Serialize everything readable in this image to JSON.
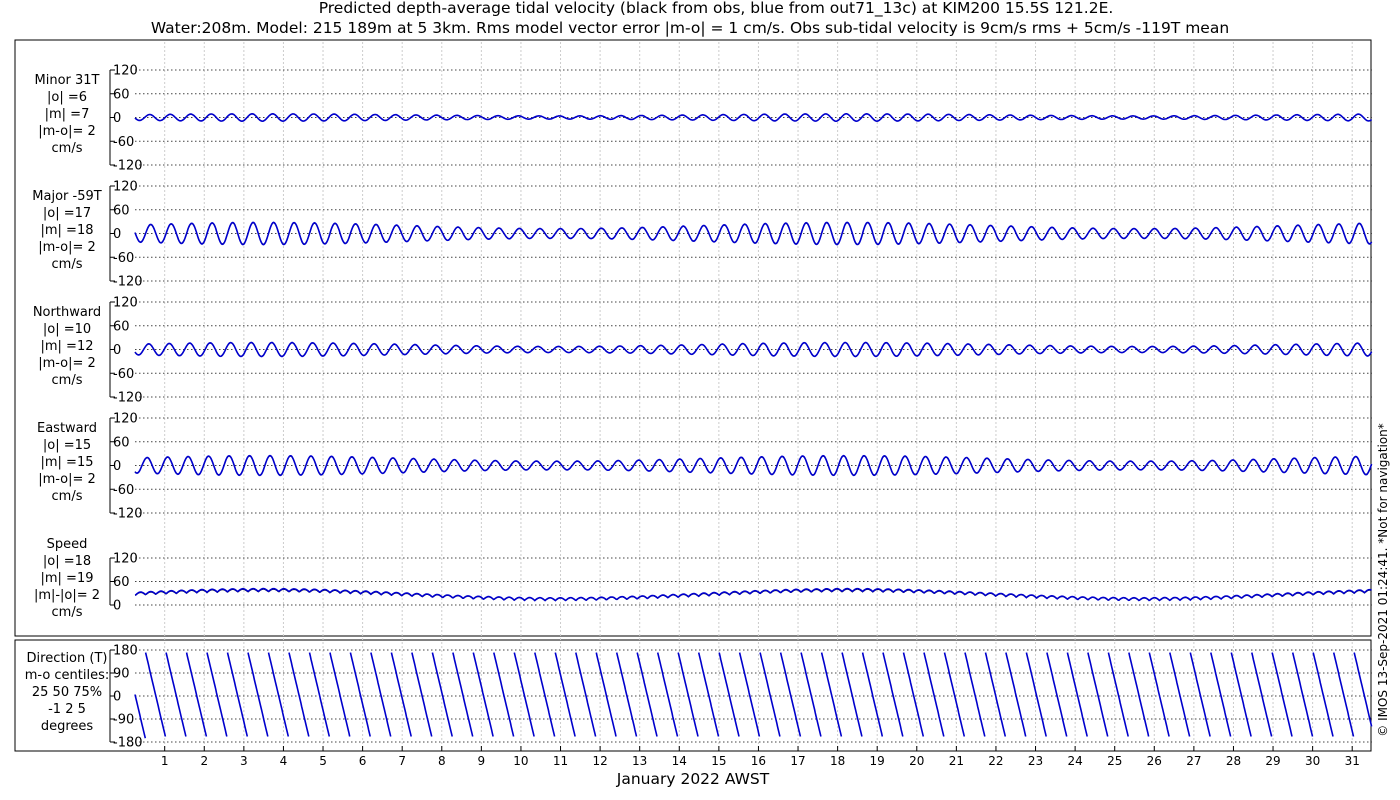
{
  "title_line1": "Predicted depth-average tidal velocity (black from obs, blue from out71_13c) at KIM200 15.5S 121.2E.",
  "title_line2": "Water:208m. Model: 215 189m at 5 3km. Rms model vector error |m-o| = 1 cm/s. Obs sub-tidal velocity is 9cm/s rms + 5cm/s -119T mean",
  "xlabel": "January 2022 AWST",
  "copyright": "© IMOS 13-Sep-2021 01:24:41. *Not for navigation*",
  "colors": {
    "obs": "#000000",
    "model": "#0000cc"
  },
  "chart_data": {
    "type": "line",
    "x_day_range": [
      0.25,
      31.5
    ],
    "x_ticks": [
      "1",
      "2",
      "3",
      "4",
      "5",
      "6",
      "7",
      "8",
      "9",
      "10",
      "11",
      "12",
      "13",
      "14",
      "15",
      "16",
      "17",
      "18",
      "19",
      "20",
      "21",
      "22",
      "23",
      "24",
      "25",
      "26",
      "27",
      "28",
      "29",
      "30",
      "31"
    ],
    "panels": [
      {
        "key": "minor",
        "labels": [
          "Minor 31T",
          "|o| =6",
          "|m| =7",
          "|m-o|= 2",
          "cm/s"
        ],
        "ylim": [
          -120,
          120
        ],
        "yticks": [
          "120",
          "60",
          "0",
          "-60",
          "-120"
        ],
        "amplitude": 9,
        "mean": 0
      },
      {
        "key": "major",
        "labels": [
          "Major -59T",
          "|o| =17",
          "|m| =18",
          "|m-o|= 2",
          "cm/s"
        ],
        "ylim": [
          -120,
          120
        ],
        "yticks": [
          "120",
          "60",
          "0",
          "-60",
          "-120"
        ],
        "amplitude": 27,
        "mean": 0
      },
      {
        "key": "north",
        "labels": [
          "Northward",
          "|o| =10",
          "|m| =12",
          "|m-o|= 2",
          "cm/s"
        ],
        "ylim": [
          -120,
          120
        ],
        "yticks": [
          "120",
          "60",
          "0",
          "-60",
          "-120"
        ],
        "amplitude": 17,
        "mean": 0
      },
      {
        "key": "east",
        "labels": [
          "Eastward",
          "|o| =15",
          "|m| =15",
          "|m-o|= 2",
          "cm/s"
        ],
        "ylim": [
          -120,
          120
        ],
        "yticks": [
          "120",
          "60",
          "0",
          "-60",
          "-120"
        ],
        "amplitude": 24,
        "mean": 0
      },
      {
        "key": "speed",
        "labels": [
          "Speed",
          "|o| =18",
          "|m| =19",
          "|m|-|o|= 2",
          "cm/s"
        ],
        "ylim": [
          0,
          120
        ],
        "yticks": [
          "120",
          "60",
          "0"
        ],
        "amplitude": 7,
        "mean": 22
      },
      {
        "key": "direction",
        "labels": [
          "Direction (T)",
          "m-o centiles:",
          "25  50  75%",
          "-1  2  5",
          "degrees"
        ],
        "ylim": [
          -180,
          180
        ],
        "yticks": [
          "180",
          "90",
          "0",
          "-90",
          "-180"
        ]
      }
    ],
    "series": [
      {
        "name": "black from obs"
      },
      {
        "name": "blue from out71_13c"
      }
    ],
    "period_hours": 12.42,
    "spring_neap_days": 14.77,
    "grid": true
  }
}
